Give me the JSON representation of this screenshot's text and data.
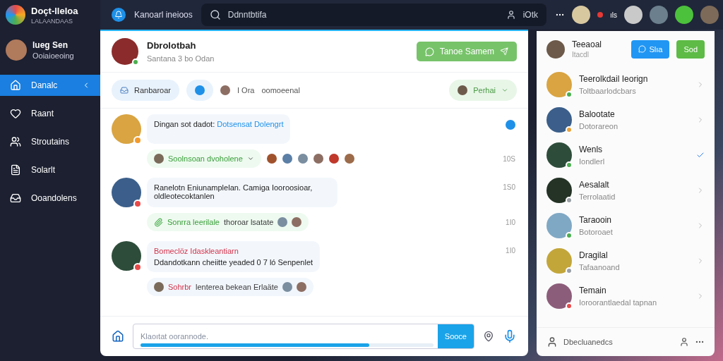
{
  "app": {
    "name": "Doçt-lleloa",
    "subtitle": "LALAANDAAS"
  },
  "user": {
    "name": "lueg Sen",
    "status": "Ooiaioeoing"
  },
  "nav": [
    {
      "label": "Danalc",
      "selected": true
    },
    {
      "label": "Raant",
      "selected": false
    },
    {
      "label": "Stroutains",
      "selected": false
    },
    {
      "label": "Solarlt",
      "selected": false
    },
    {
      "label": "Ooandolens",
      "selected": false
    }
  ],
  "topbar": {
    "title": "Kanoarl ineioos",
    "search_placeholder": "Ddnntbtifa",
    "search_count": "iOtk",
    "live_label": "ıls"
  },
  "chat": {
    "name": "Dbrolotbah",
    "subtitle": "Santana 3 bo Odan",
    "action": "Tanoe Samem",
    "filter": {
      "chip": "Ranbaroar",
      "count": "I Ora",
      "label": "oomoeenal",
      "person": "Perhai"
    },
    "messages": [
      {
        "kind": "linked",
        "text": "Dingan sot dadot:",
        "link": "Dotsensat Dolengrt",
        "color": "#f39a2b",
        "reply": {
          "kind": "people",
          "label": "Soolnsoan dvoholene"
        },
        "time": "10S"
      },
      {
        "kind": "plain",
        "text": "Ranelotn Eniunamplelan. Camiga Iooroosioar, oldleotecoktanlen",
        "color": "#e84a4a",
        "time": "1S0",
        "reply": {
          "kind": "attachment",
          "label": "Sonrra leerilale",
          "rest": "thoroar lsatate"
        },
        "reply_time": "1I0"
      },
      {
        "kind": "card",
        "title": "Bomeclöz Idaskleantiarn",
        "text": "Ddandotkann cheiitte yeaded 0 7 ló Senpenlet",
        "color": "#e84a4a",
        "time": "1I0",
        "reply": {
          "kind": "mention",
          "label": "Sohrbr",
          "rest": "lenterea bekean Erlaäte"
        }
      }
    ],
    "composer": {
      "placeholder": "Klaoıtat oorannode.",
      "button": "Sooce",
      "level": 0.78
    }
  },
  "panel": {
    "title": "Teeaoal",
    "subtitle": "Itacdl",
    "buttons": [
      {
        "label": "Slıa",
        "kind": "primary"
      },
      {
        "label": "Sod",
        "kind": "success"
      }
    ],
    "contacts": [
      {
        "name": "Teerolkdail Ieorign",
        "status": "Toltbaarlodcbars",
        "color": "#4caf50",
        "selected": false
      },
      {
        "name": "Balootate",
        "status": "Dotorareon",
        "color": "#e9a23b",
        "selected": false
      },
      {
        "name": "Wenls",
        "status": "Iondlerl",
        "color": "#4caf50",
        "selected": true
      },
      {
        "name": "Aesalalt",
        "status": "Terrolaatid",
        "color": "#9aa0a6",
        "selected": false
      },
      {
        "name": "Taraooin",
        "status": "Botoroaet",
        "color": "#4caf50",
        "selected": false
      },
      {
        "name": "Dragilal",
        "status": "Tafaanoand",
        "color": "#9aa0a6",
        "selected": false
      },
      {
        "name": "Temain",
        "status": "Ioroorantlaedal tapnan",
        "color": "#e84a4a",
        "selected": false
      }
    ],
    "footer": "Dbecluanedcs"
  }
}
